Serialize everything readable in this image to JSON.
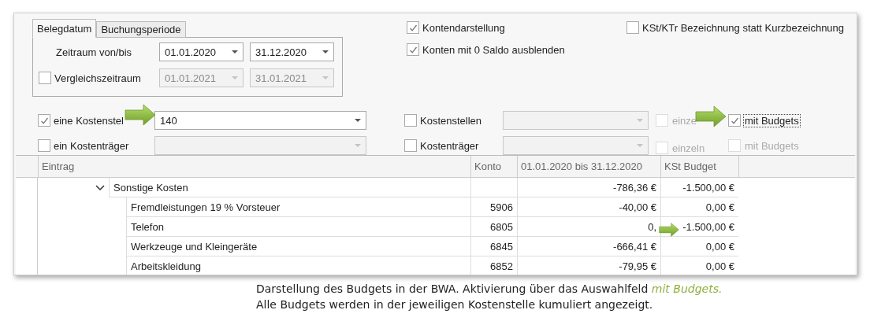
{
  "date_tabs": [
    {
      "label": "Belegdatum",
      "selected": true
    },
    {
      "label": "Buchungsperiode",
      "selected": false
    }
  ],
  "period": {
    "label": "Zeitraum von/bis",
    "from": "01.01.2020",
    "to": "31.12.2020"
  },
  "comparison": {
    "label": "Vergleichszeitraum",
    "checked": false,
    "disabled": true,
    "from": "01.01.2021",
    "to": "31.01.2021"
  },
  "options": [
    {
      "label": "Kontendarstellung",
      "checked": true
    },
    {
      "label": "Konten mit 0 Saldo ausblenden",
      "checked": true
    }
  ],
  "name_option": {
    "label": "KSt/KTr Bezeichnung statt Kurzbezeichnung",
    "checked": false
  },
  "left_filters": [
    {
      "label": "eine Kostenstel",
      "checked": true,
      "disabled": false,
      "value": "140"
    },
    {
      "label": "ein Kostenträger",
      "checked": false,
      "disabled": true
    }
  ],
  "right_filters": [
    {
      "label": "Kostenstellen",
      "checked": false,
      "disabled": true,
      "single": {
        "label": "einze",
        "checked": false,
        "disabled": true
      },
      "budgets": {
        "label": "mit Budgets",
        "checked": true,
        "disabled": false,
        "focused": true
      }
    },
    {
      "label": "Kostenträger",
      "checked": false,
      "disabled": true,
      "single": {
        "label": "einzeln",
        "checked": false,
        "disabled": true
      },
      "budgets": {
        "label": "mit Budgets",
        "checked": false,
        "disabled": true,
        "focused": false
      }
    }
  ],
  "table": {
    "columns": [
      "Eintrag",
      "Konto",
      "01.01.2020 bis 31.12.2020",
      "KSt Budget"
    ],
    "rows": [
      {
        "entry": "Sonstige Kosten",
        "expanded": true,
        "amount": "-786,36 €",
        "budget": "-1.500,00 €",
        "children": [
          {
            "entry": "Fremdleistungen 19 % Vorsteuer",
            "konto": "5906",
            "amount": "-40,00 €",
            "budget": "0,00 €"
          },
          {
            "entry": "Telefon",
            "konto": "6805",
            "amount": "0,",
            "budget": "-1.500,00 €"
          },
          {
            "entry": "Werkzeuge und Kleingeräte",
            "konto": "6845",
            "amount": "-666,41 €",
            "budget": "0,00 €"
          },
          {
            "entry": "Arbeitskleidung",
            "konto": "6852",
            "amount": "-79,95 €",
            "budget": "0,00 €"
          }
        ]
      }
    ]
  },
  "caption": [
    "Darstellung des Budgets in der BWA. Aktivierung  über das Auswahlfeld *mit Budgets.*",
    "Alle Budgets werden in der jeweiligen Kostenstelle kumuliert angezeigt."
  ]
}
